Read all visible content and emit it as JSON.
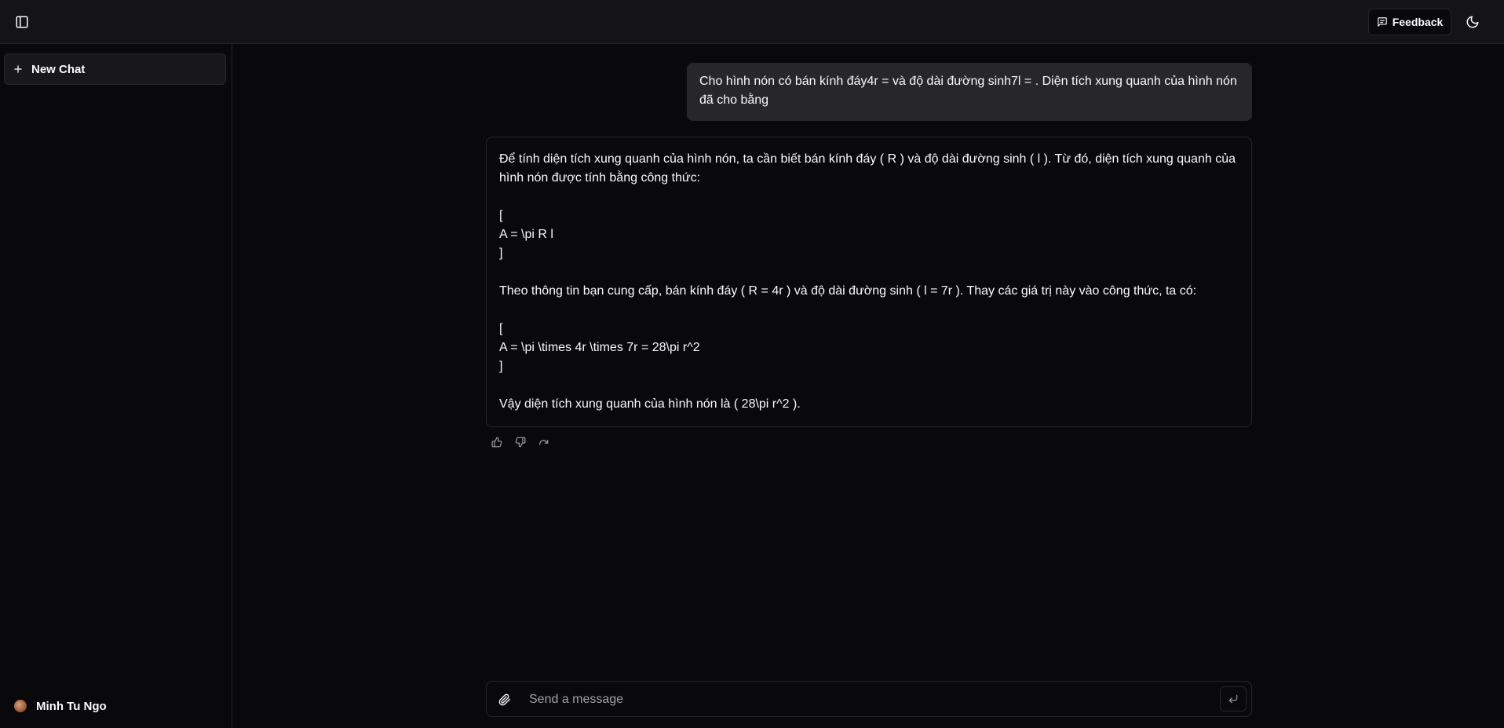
{
  "header": {
    "sidebar_toggle_icon": "panel-left-icon",
    "feedback_label": "Feedback",
    "feedback_icon": "message-square-icon",
    "theme_icon": "moon-icon"
  },
  "sidebar": {
    "new_chat_label": "New Chat",
    "new_chat_icon": "plus-icon",
    "user_name": "Minh Tu Ngo"
  },
  "chat": {
    "user_message": "Cho hình nón có bán kính đáy4r = và độ dài đường sinh7l = . Diện tích xung quanh của hình nón đã cho bằng",
    "assistant_message": "Để tính diện tích xung quanh của hình nón, ta cần biết bán kính đáy ( R ) và độ dài đường sinh ( l ). Từ đó, diện tích xung quanh của hình nón được tính bằng công thức:\n\n[\nA = \\pi R l\n]\n\nTheo thông tin bạn cung cấp, bán kính đáy ( R = 4r ) và độ dài đường sinh ( l = 7r ). Thay các giá trị này vào công thức, ta có:\n\n[\nA = \\pi \\times 4r \\times 7r = 28\\pi r^2\n]\n\nVậy diện tích xung quanh của hình nón là ( 28\\pi r^2 ).",
    "actions": [
      "thumbs-up-icon",
      "thumbs-down-icon",
      "redo-icon"
    ]
  },
  "composer": {
    "placeholder": "Send a message",
    "attach_icon": "paperclip-icon",
    "send_icon": "corner-down-left-icon"
  },
  "colors": {
    "background": "#09090b",
    "header_bg": "#141416",
    "bubble_bg": "#27272a",
    "border": "#27272a",
    "text": "#fafafa",
    "muted": "#a1a1aa"
  }
}
